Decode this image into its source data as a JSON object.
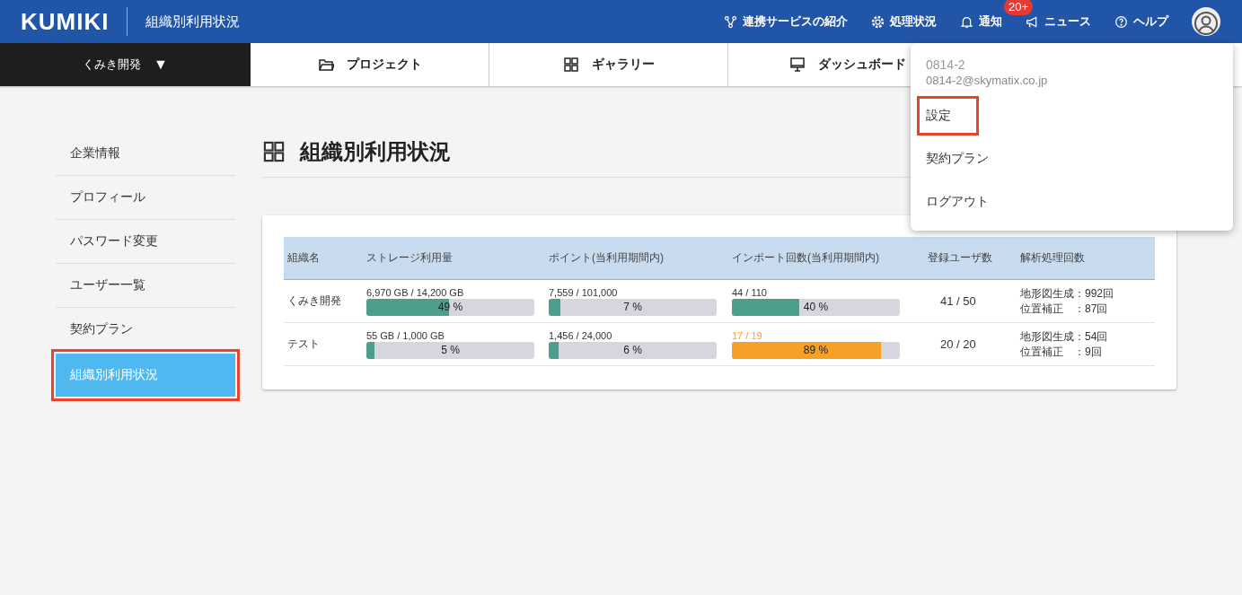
{
  "header": {
    "logo": "KUMIKI",
    "title": "組織別利用状況",
    "links": [
      {
        "kind": "share",
        "label": "連携サービスの紹介"
      },
      {
        "kind": "gear",
        "label": "処理状況"
      },
      {
        "kind": "bell",
        "label": "通知",
        "badge": "20+"
      },
      {
        "kind": "megaphone",
        "label": "ニュース"
      },
      {
        "kind": "help",
        "label": "ヘルプ"
      }
    ]
  },
  "org_selector": {
    "label": "くみき開発",
    "caret": "▼"
  },
  "nav_tabs": [
    {
      "kind": "folder",
      "label": "プロジェクト"
    },
    {
      "kind": "grid",
      "label": "ギャラリー"
    },
    {
      "kind": "monitor",
      "label": "ダッシュボード"
    }
  ],
  "user_menu": {
    "user_name": "0814-2",
    "email": "0814-2@skymatix.co.jp",
    "items": [
      {
        "label": "設定",
        "annotated": true
      },
      {
        "label": "契約プラン",
        "annotated": false
      },
      {
        "label": "ログアウト",
        "annotated": false
      }
    ]
  },
  "sidebar": {
    "items": [
      {
        "label": "企業情報",
        "selected": false,
        "annotated": false
      },
      {
        "label": "プロフィール",
        "selected": false,
        "annotated": false
      },
      {
        "label": "パスワード変更",
        "selected": false,
        "annotated": false
      },
      {
        "label": "ユーザー一覧",
        "selected": false,
        "annotated": false
      },
      {
        "label": "契約プラン",
        "selected": false,
        "annotated": false
      },
      {
        "label": "組織別利用状況",
        "selected": true,
        "annotated": true
      }
    ]
  },
  "page_title": "組織別利用状況",
  "table": {
    "columns": [
      "組織名",
      "ストレージ利用量",
      "ポイント(当利用期間内)",
      "インポート回数(当利用期間内)",
      "登録ユーザ数",
      "解析処理回数"
    ],
    "rows": [
      {
        "name": "くみき開発",
        "usage": [
          {
            "amount": "6,970 GB / 14,200 GB",
            "percent": "49 %",
            "level": 0.49,
            "warning": false
          },
          {
            "amount": "7,559 / 101,000",
            "percent": "7 %",
            "level": 0.07,
            "warning": false
          },
          {
            "amount": "44 / 110",
            "percent": "40 %",
            "level": 0.4,
            "warning": false
          }
        ],
        "users": "41 / 50",
        "analysis": [
          {
            "label": "地形図生成",
            "value": "：992回"
          },
          {
            "label": "位置補正",
            "value": "：87回"
          }
        ]
      },
      {
        "name": "テスト",
        "usage": [
          {
            "amount": "55 GB / 1,000 GB",
            "percent": "5 %",
            "level": 0.05,
            "warning": false
          },
          {
            "amount": "1,456 / 24,000",
            "percent": "6 %",
            "level": 0.06,
            "warning": false
          },
          {
            "amount": "17 / 19",
            "percent": "89 %",
            "level": 0.89,
            "warning": true
          }
        ],
        "users": "20 / 20",
        "analysis": [
          {
            "label": "地形図生成",
            "value": "：54回"
          },
          {
            "label": "位置補正",
            "value": "：9回"
          }
        ]
      }
    ]
  }
}
